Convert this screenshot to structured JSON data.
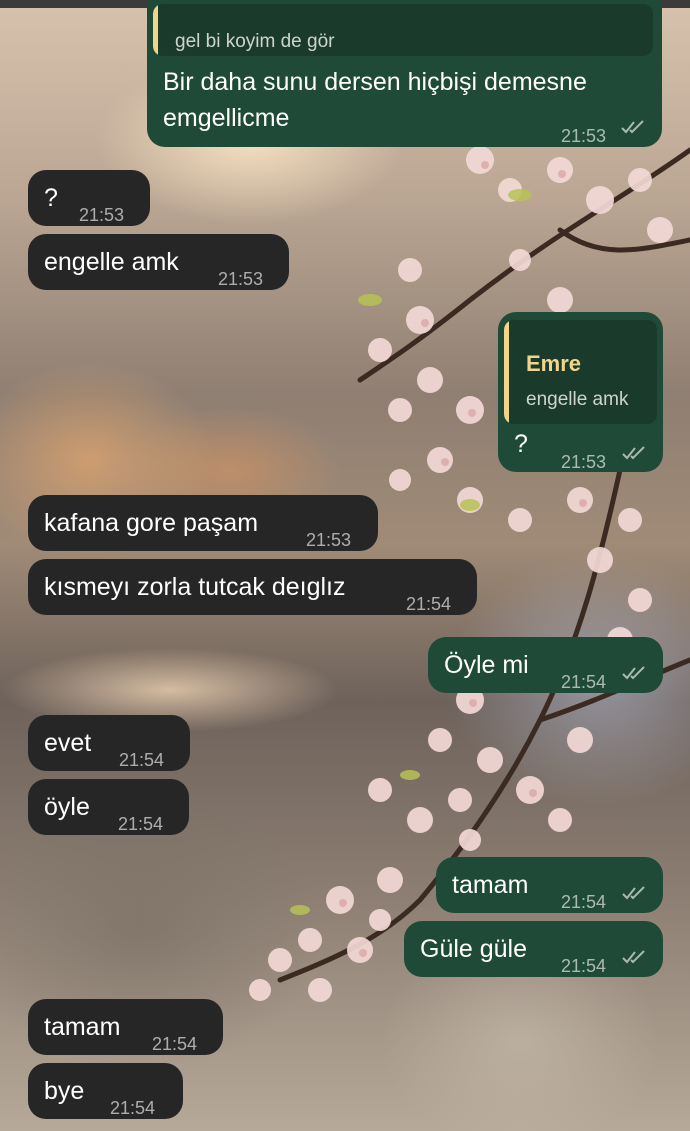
{
  "chat": {
    "messages": [
      {
        "dir": "out",
        "quote_text": "gel bi koyim de gör",
        "text": "Bir daha sunu dersen hiçbişi demesne emgellicme",
        "time": "21:53"
      },
      {
        "dir": "in",
        "text": "?",
        "time": "21:53"
      },
      {
        "dir": "in",
        "text": "engelle amk",
        "time": "21:53"
      },
      {
        "dir": "out",
        "quote_name": "Emre",
        "quote_text": "engelle amk",
        "text": "?",
        "time": "21:53"
      },
      {
        "dir": "in",
        "text": "kafana gore paşam",
        "time": "21:53"
      },
      {
        "dir": "in",
        "text": "kısmeyı zorla tutcak deıglız",
        "time": "21:54"
      },
      {
        "dir": "out",
        "text": "Öyle mi",
        "time": "21:54"
      },
      {
        "dir": "in",
        "text": "evet",
        "time": "21:54"
      },
      {
        "dir": "in",
        "text": "öyle",
        "time": "21:54"
      },
      {
        "dir": "out",
        "text": "tamam",
        "time": "21:54"
      },
      {
        "dir": "out",
        "text": "Güle güle",
        "time": "21:54"
      },
      {
        "dir": "in",
        "text": "tamam",
        "time": "21:54"
      },
      {
        "dir": "in",
        "text": "bye",
        "time": "21:54"
      }
    ]
  },
  "colors": {
    "incoming_bubble": "#262626",
    "outgoing_bubble": "#1f4a37",
    "quote_accent": "#f1d58b"
  },
  "icons": {
    "read_receipt": "double-check-icon"
  }
}
